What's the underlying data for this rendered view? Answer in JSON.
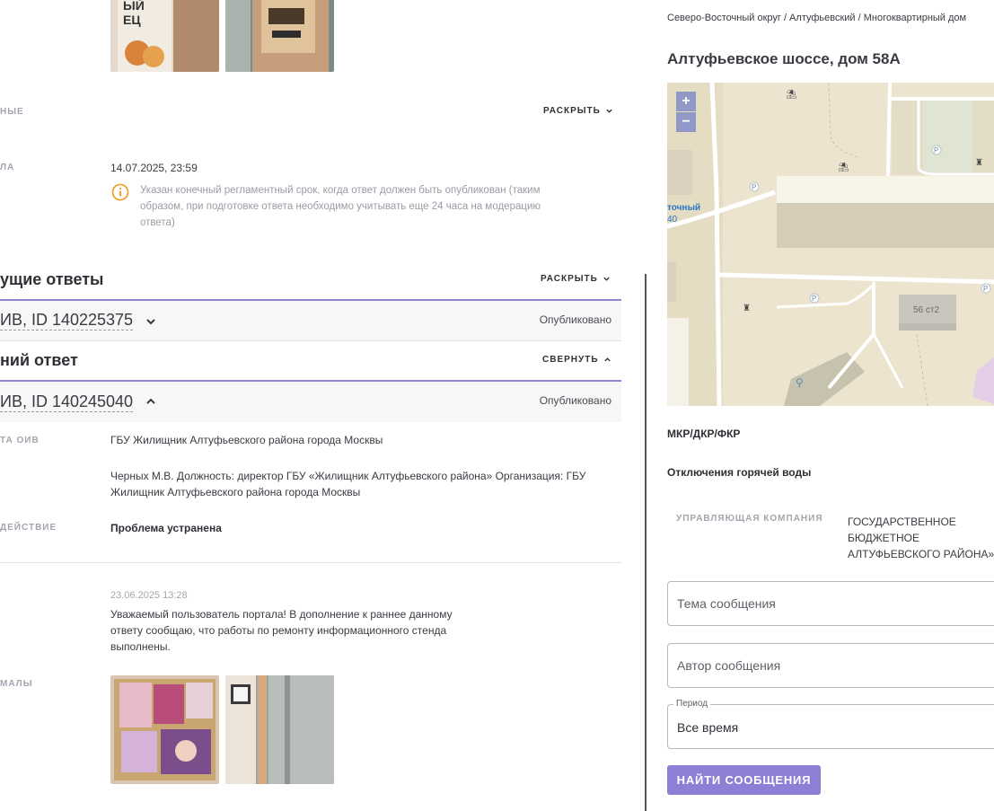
{
  "left": {
    "rows": {
      "row1_label": "НЫЕ",
      "row1_toggle": "РАСКРЫТЬ",
      "row2_label": "ЛА",
      "deadline_value": "14.07.2025, 23:59",
      "deadline_note": "Указан конечный регламентный срок, когда ответ должен быть опубликован (таким образом, при подготовке ответа необходимо учитывать еще 24 часа на модерацию ответа)"
    },
    "previous": {
      "title": "ущие ответы",
      "toggle": "РАСКРЫТЬ",
      "item_title": "ИВ, ID 140225375",
      "item_status": "Опубликовано"
    },
    "last": {
      "title": "ний ответ",
      "toggle": "СВЕРНУТЬ",
      "item_title": "ИВ, ID 140245040",
      "item_status": "Опубликовано",
      "org_label": "ТА ОИВ",
      "org_value": "ГБУ Жилищник Алтуфьевского района города Москвы",
      "signer_value": "Черных М.В. Должность: директор ГБУ «Жилищник Алтуфьевского района» Организация: ГБУ Жилищник Алтуфьевского района города Москвы",
      "action_label": "ДЕЙСТВИЕ",
      "action_value": "Проблема устранена",
      "msg_date": "23.06.2025 13:28",
      "msg_text": "Уважаемый пользователь портала! В дополнение к раннее данному ответу сообщаю, что работы по ремонту информационного стенда выполнены.",
      "photos_label": "МАЛЫ"
    }
  },
  "right": {
    "breadcrumb": "Северо-Восточный округ / Алтуфьевский / Многоквартирный дом",
    "address": "Алтуфьевское шоссе, дом 58А",
    "map": {
      "zoom_in": "+",
      "zoom_out": "−",
      "road_label_1": "точный",
      "road_label_2": "40",
      "building_label": "56 ст2",
      "parking": "P"
    },
    "info1": "МКР/ДКР/ФКР",
    "info2": "Отключения горячей воды",
    "company_label": "УПРАВЛЯЮЩАЯ КОМПАНИЯ",
    "company_value": "ГОСУДАРСТВЕННОЕ БЮДЖЕТНОЕ АЛТУФЬЕВСКОГО РАЙОНА»",
    "topic_placeholder": "Тема сообщения",
    "author_placeholder": "Автор сообщения",
    "period_legend": "Период",
    "period_value": "Все время",
    "search_button": "НАЙТИ СООБЩЕНИЯ"
  },
  "colors": {
    "accent": "#8c7fd5",
    "accordion_border": "#8f86d4",
    "info_icon": "#f29a1c",
    "map_bg": "#ece4cf"
  }
}
